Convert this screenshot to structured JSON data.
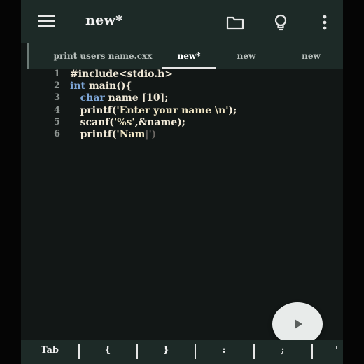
{
  "header": {
    "title": "new*",
    "icons": [
      "menu-icon",
      "folder-icon",
      "lightbulb-icon",
      "more-vert-icon"
    ]
  },
  "tabs": [
    {
      "label": "print users name.cxx",
      "active": false
    },
    {
      "label": "new*",
      "active": true
    },
    {
      "label": "new",
      "active": false
    },
    {
      "label": "new",
      "active": false
    }
  ],
  "editor": {
    "lines": [
      {
        "number": "1",
        "segments": [
          {
            "text": "#include<stdio.h>",
            "kind": "pp"
          }
        ]
      },
      {
        "number": "2",
        "segments": [
          {
            "text": "int",
            "kind": "kw"
          },
          {
            "text": " main(){",
            "kind": "tx"
          }
        ]
      },
      {
        "number": "3",
        "segments": [
          {
            "text": "   char",
            "kind": "kw"
          },
          {
            "text": " name [10];",
            "kind": "tx"
          }
        ]
      },
      {
        "number": "4",
        "segments": [
          {
            "text": "   printf(",
            "kind": "tx"
          },
          {
            "text": "'Enter your name \\n'",
            "kind": "str"
          },
          {
            "text": ");",
            "kind": "tx"
          }
        ]
      },
      {
        "number": "5",
        "segments": [
          {
            "text": "   scanf(",
            "kind": "tx"
          },
          {
            "text": "'%s'",
            "kind": "str"
          },
          {
            "text": ",&name);",
            "kind": "tx"
          }
        ]
      },
      {
        "number": "6",
        "segments": [
          {
            "text": "   printf(",
            "kind": "tx"
          },
          {
            "text": "'Nam",
            "kind": "str"
          },
          {
            "text": "|')",
            "kind": "hint"
          }
        ]
      }
    ]
  },
  "run_button": {
    "icon": "play-icon"
  },
  "keybar": {
    "keys": [
      "Tab",
      "{",
      "}",
      ":",
      ";",
      "'"
    ]
  }
}
